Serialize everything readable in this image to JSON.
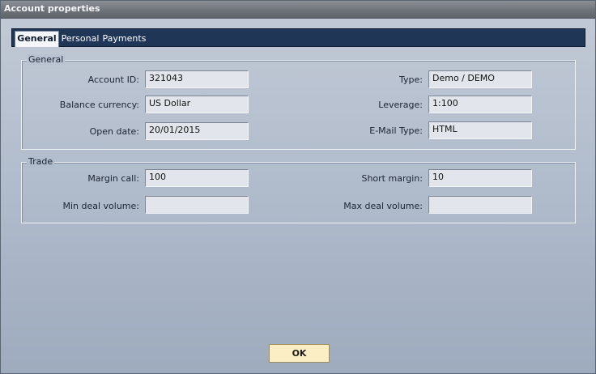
{
  "window": {
    "title": "Account properties"
  },
  "tabs": [
    {
      "label": "General",
      "active": true
    },
    {
      "label": "Personal",
      "active": false
    },
    {
      "label": "Payments",
      "active": false
    }
  ],
  "general": {
    "label": "General",
    "account_id": {
      "label": "Account ID:",
      "value": "321043"
    },
    "balance_currency": {
      "label": "Balance currency:",
      "value": "US Dollar"
    },
    "open_date": {
      "label": "Open date:",
      "value": "20/01/2015"
    },
    "type": {
      "label": "Type:",
      "value": "Demo / DEMO"
    },
    "leverage": {
      "label": "Leverage:",
      "value": "1:100"
    },
    "email_type": {
      "label": "E-Mail Type:",
      "value": "HTML"
    }
  },
  "trade": {
    "label": "Trade",
    "margin_call": {
      "label": "Margin call:",
      "value": "100"
    },
    "min_deal_volume": {
      "label": "Min deal volume:",
      "value": ""
    },
    "short_margin": {
      "label": "Short margin:",
      "value": "10"
    },
    "max_deal_volume": {
      "label": "Max deal volume:",
      "value": ""
    }
  },
  "buttons": {
    "ok": "OK"
  },
  "colors": {
    "tabbar": "#203656",
    "ok_button": "#fbedc4",
    "titlebar": "#6f737a"
  }
}
